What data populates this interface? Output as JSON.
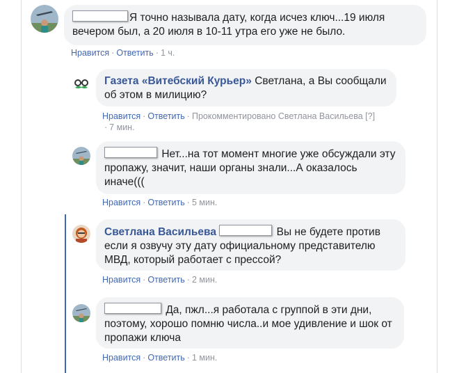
{
  "actions": {
    "like": "Нравится",
    "reply": "Ответить",
    "sep": "·"
  },
  "comments": [
    {
      "author": "",
      "text": "Я точно называла дату, когда исчез ключ...19 июля вечером был, а 20 июля в 10-11 утра его уже не было.",
      "time": "1 ч."
    },
    {
      "author": "Газета «Витебский Курьер»",
      "text": "Светлана, а Вы сообщали об этом в милицию?",
      "note": "Прокомментировано Светлана Васильева",
      "note_help": "[?]",
      "time": "7 мин."
    },
    {
      "author": "",
      "text": "Нет...на тот момент многие уже обсуждали эту пропажу, значит, наши органы знали...А оказалось иначе(((",
      "time": "5 мин."
    },
    {
      "author": "Светлана Васильева",
      "text": "Вы не будете против если я озвучу эту дату официальному представителю МВД, который работает с прессой?",
      "time": "2 мин."
    },
    {
      "author": "",
      "text": "Да, пжл...я работала с группой в эти дни, поэтому, хорошо помню числа..и мое удивление и шок от пропажи ключа",
      "time": "1 мин."
    }
  ]
}
